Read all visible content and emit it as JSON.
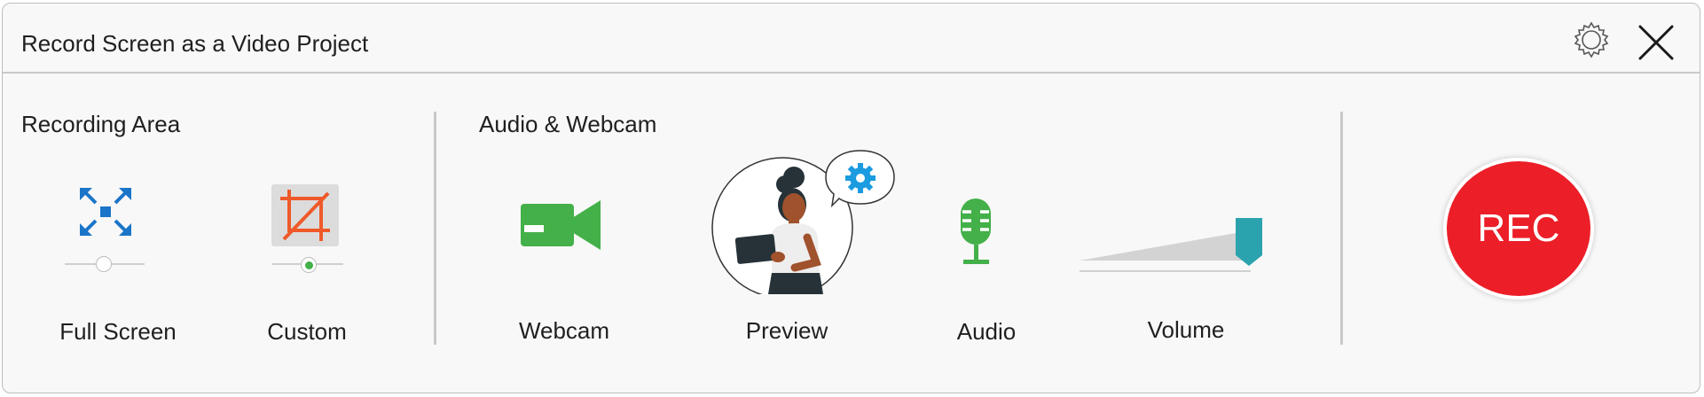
{
  "window": {
    "title": "Record Screen as a Video Project"
  },
  "titlebar": {
    "settings_icon": "gear-icon",
    "close_icon": "close-icon"
  },
  "recording_area": {
    "heading": "Recording Area",
    "options": [
      {
        "label": "Full Screen",
        "icon": "fullscreen-expand-icon",
        "selected": false
      },
      {
        "label": "Custom",
        "icon": "crop-icon",
        "selected": true
      }
    ]
  },
  "audio_webcam": {
    "heading": "Audio & Webcam",
    "webcam_label": "Webcam",
    "preview_label": "Preview",
    "audio_label": "Audio",
    "volume_label": "Volume",
    "volume_level": 0.92
  },
  "record": {
    "button_label": "REC"
  },
  "colors": {
    "rec_red": "#ec1e27",
    "accent_blue": "#1a75c9",
    "crop_orange": "#ef5a2a",
    "webcam_green": "#43b049",
    "volume_teal": "#2ba3ae"
  }
}
